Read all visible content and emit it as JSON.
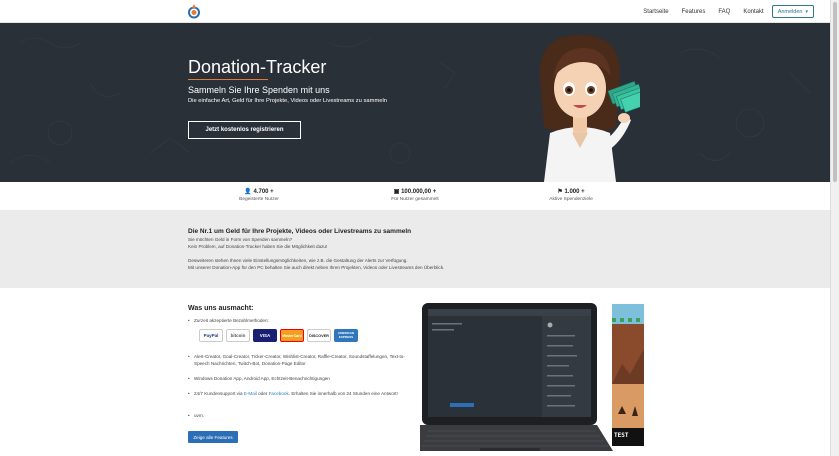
{
  "nav": {
    "logo_icon": "donation-tracker-logo",
    "links": [
      "Startseite",
      "Features",
      "FAQ",
      "Kontakt"
    ],
    "login_label": "Anmelden",
    "login_caret": "▾"
  },
  "hero": {
    "title": "Donation-Tracker",
    "subtitle": "Sammeln Sie Ihre Spenden mit uns",
    "tagline": "Die einfache Art, Geld für Ihre Projekte, Videos oder Livestreams zu sammeln",
    "cta_label": "Jetzt kostenlos registrieren"
  },
  "stats": [
    {
      "icon": "users-icon",
      "glyph": "👤",
      "value": "4.700 +",
      "label": "Begeisterte Nutzer"
    },
    {
      "icon": "money-icon",
      "glyph": "▣",
      "value": "100.000,00 +",
      "label": "Für Nutzer gesammelt"
    },
    {
      "icon": "flag-icon",
      "glyph": "⚑",
      "value": "1.000 +",
      "label": "Aktive Spendenziele"
    }
  ],
  "info": {
    "title": "Die Nr.1 um Geld für Ihre Projekte, Videos oder Livestreams zu sammeln",
    "lines": [
      "Sie möchten Geld in Form von Spenden sammeln?",
      "Kein Problem, auf Donation-Tracker haben Sie die Möglichkeit dazu!",
      "Desweiteren stehen Ihnen viele Einstellungsmöglichkeiten, wie z.B. die Gestaltung der Alerts zur Verfügung.",
      "Mit unserer Donation-App für den PC behalten Sie auch direkt neben Ihren Projekten, Videos oder Livestreams den Überblick."
    ]
  },
  "features": {
    "title": "Was uns ausmacht:",
    "payment_intro": "Zurzeit akzeptierte Bezahlmethoden:",
    "payments": [
      "PayPal",
      "bitcoin",
      "VISA",
      "MasterCard",
      "DISCOVER",
      "AMERICAN EXPRESS"
    ],
    "item_tools": "Alert-Creator, Goal-Creator, Ticker-Creator, Wishlist-Creator, Raffle-Creator, Soundstaffelungen, Text-to-Speech Nachrichten, Twitch-Bot, Donation-Page Editor",
    "item_apps": "Windows Donation App, Android App, Echtzeit-Benachrichtigungen",
    "support_pre": "24/7 Kundensupport via ",
    "support_email": "E-Mail",
    "support_mid": " oder ",
    "support_fb": "Facebook",
    "support_post": ". Erhalten Sie innerhalb von 24 Stunden eine Antwort!",
    "item_more": "uvm.",
    "button_label": "Zeige alle Features",
    "panel_text": "TEST"
  }
}
